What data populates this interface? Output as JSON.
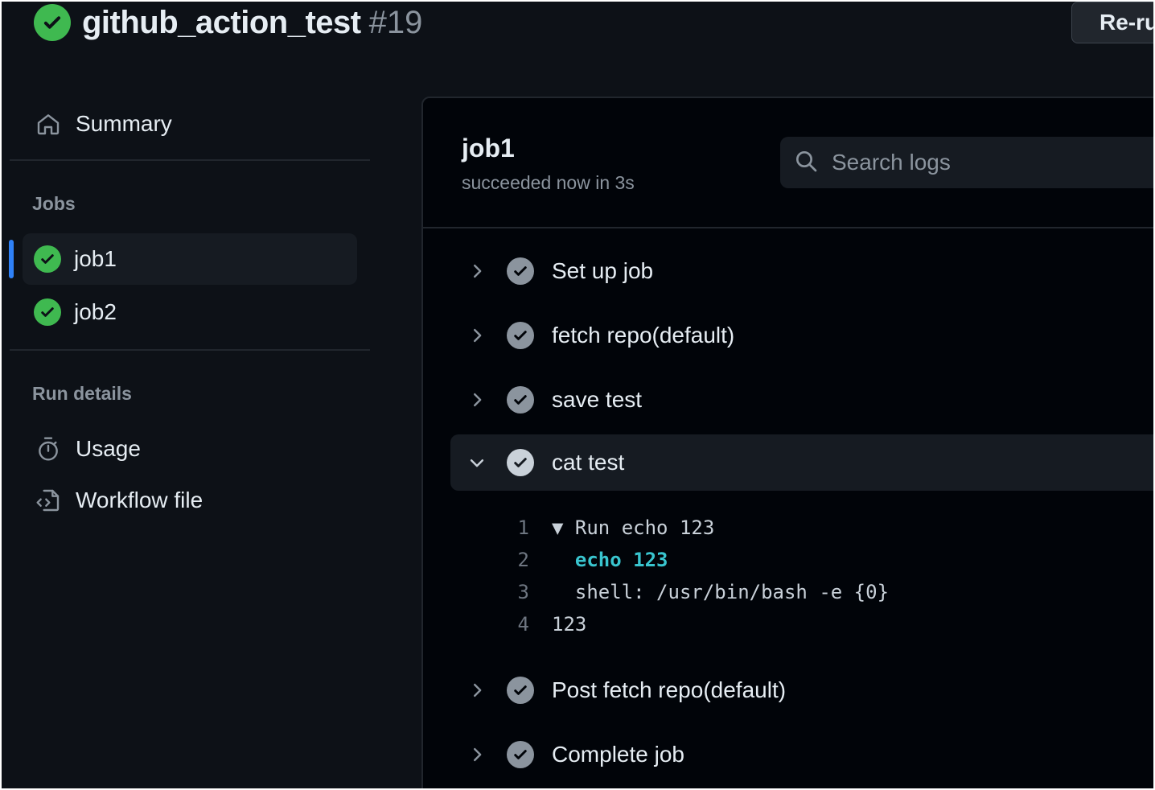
{
  "header": {
    "workflow_name": "github_action_test",
    "run_number": "#19",
    "rerun_label": "Re-ru"
  },
  "sidebar": {
    "summary_label": "Summary",
    "jobs_heading": "Jobs",
    "jobs": [
      {
        "label": "job1",
        "status": "success",
        "active": true
      },
      {
        "label": "job2",
        "status": "success",
        "active": false
      }
    ],
    "run_details_heading": "Run details",
    "usage_label": "Usage",
    "workflow_file_label": "Workflow file"
  },
  "job": {
    "title": "job1",
    "status_text": "succeeded now in 3s",
    "search_placeholder": "Search logs"
  },
  "steps": [
    {
      "label": "Set up job",
      "expanded": false
    },
    {
      "label": "fetch repo(default)",
      "expanded": false
    },
    {
      "label": "save test",
      "expanded": false
    },
    {
      "label": "cat test",
      "expanded": true
    },
    {
      "label": "Post fetch repo(default)",
      "expanded": false
    },
    {
      "label": "Complete job",
      "expanded": false
    }
  ],
  "log": [
    {
      "num": "1",
      "text": "▼ Run echo 123"
    },
    {
      "num": "2",
      "text": "  echo 123"
    },
    {
      "num": "3",
      "text": "  shell: /usr/bin/bash -e {0}"
    },
    {
      "num": "4",
      "text": "123"
    }
  ],
  "colors": {
    "background": "#0d1117",
    "panel": "#010409",
    "success": "#3fb950",
    "accent": "#2f81f7",
    "command": "#39c5cf"
  }
}
